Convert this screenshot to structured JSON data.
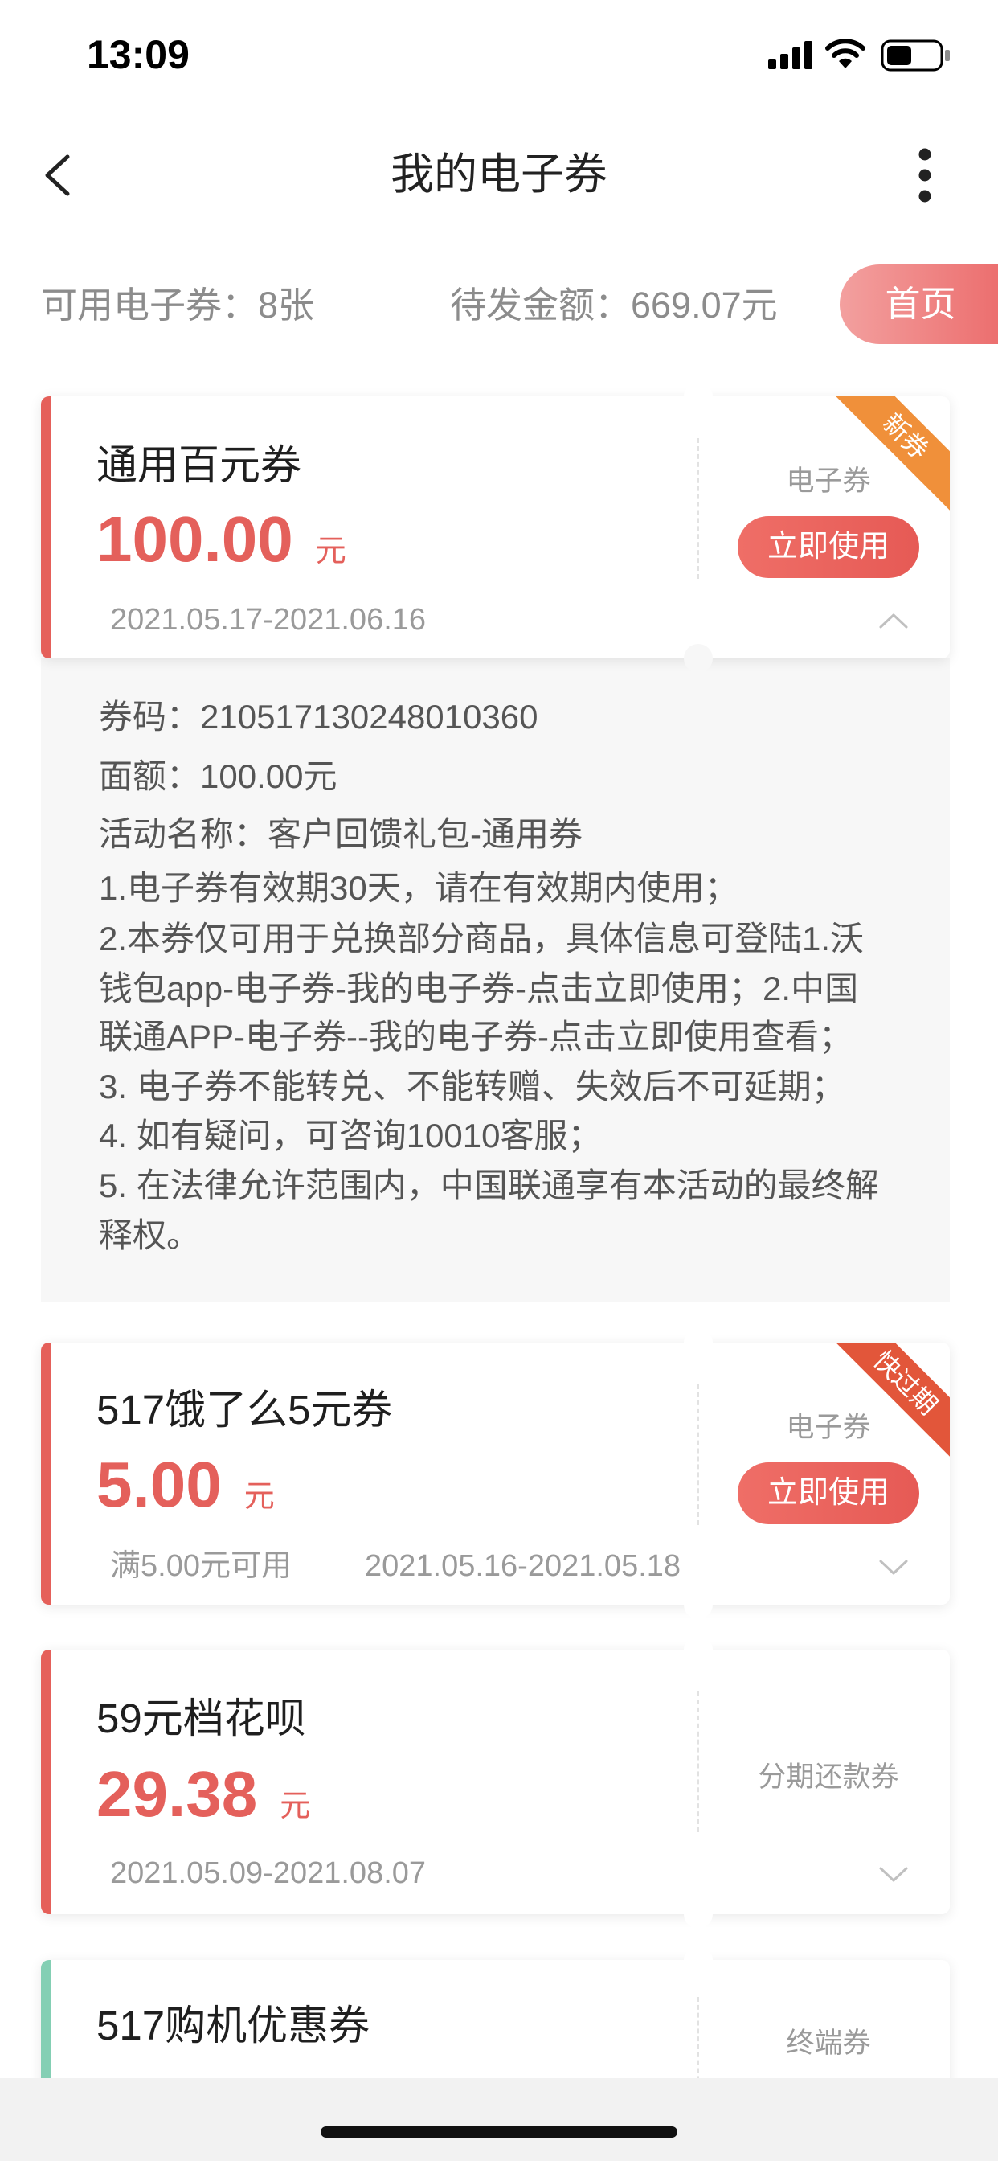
{
  "status_bar": {
    "time": "13:09",
    "icons": [
      "signal-icon",
      "wifi-icon",
      "battery-icon"
    ]
  },
  "nav": {
    "title": "我的电子券",
    "back_icon": "chevron-left-icon",
    "more_icon": "more-vertical-icon"
  },
  "summary": {
    "available": "可用电子券：8张",
    "pending": "待发金额：669.07元",
    "home_button": "首页"
  },
  "colors": {
    "accent_red": "#e5605a",
    "accent_green": "#84cfb4",
    "amount": "#e4605b",
    "ribbon_new": "#f0903a",
    "ribbon_expiring": "#e2563a",
    "muted_text": "#9a9a9a"
  },
  "coupons": [
    {
      "title": "通用百元券",
      "amount": "100.00",
      "unit": "元",
      "validity": "2021.05.17-2021.06.16",
      "type": "电子券",
      "action": "立即使用",
      "ribbon": "新券",
      "ribbon_color": "#f0903a",
      "accent": "#e5605a",
      "expanded": true,
      "chevron_icon": "chevron-up-icon",
      "details": [
        "券码：210517130248010360",
        "面额：100.00元",
        "活动名称：客户回馈礼包-通用券",
        "1.电子券有效期30天，请在有效期内使用；",
        "2.本券仅可用于兑换部分商品，具体信息可登陆1.沃",
        "钱包app-电子券-我的电子券-点击立即使用；2.中国",
        "联通APP-电子券--我的电子券-点击立即使用查看；",
        "3. 电子券不能转兑、不能转赠、失效后不可延期；",
        "4. 如有疑问，可咨询10010客服；",
        "5. 在法律允许范围内，中国联通享有本活动的最终解",
        "释权。"
      ]
    },
    {
      "title": "517饿了么5元券",
      "amount": "5.00",
      "unit": "元",
      "condition": "满5.00元可用",
      "validity": "2021.05.16-2021.05.18",
      "type": "电子券",
      "action": "立即使用",
      "ribbon": "快过期",
      "ribbon_color": "#e2563a",
      "accent": "#e5605a",
      "expanded": false,
      "chevron_icon": "chevron-down-icon"
    },
    {
      "title": "59元档花呗",
      "amount": "29.38",
      "unit": "元",
      "validity": "2021.05.09-2021.08.07",
      "type": "分期还款券",
      "accent": "#e5605a",
      "expanded": false,
      "chevron_icon": "chevron-down-icon"
    },
    {
      "title": "517购机优惠券",
      "type": "终端券",
      "accent": "#84cfb4"
    }
  ]
}
